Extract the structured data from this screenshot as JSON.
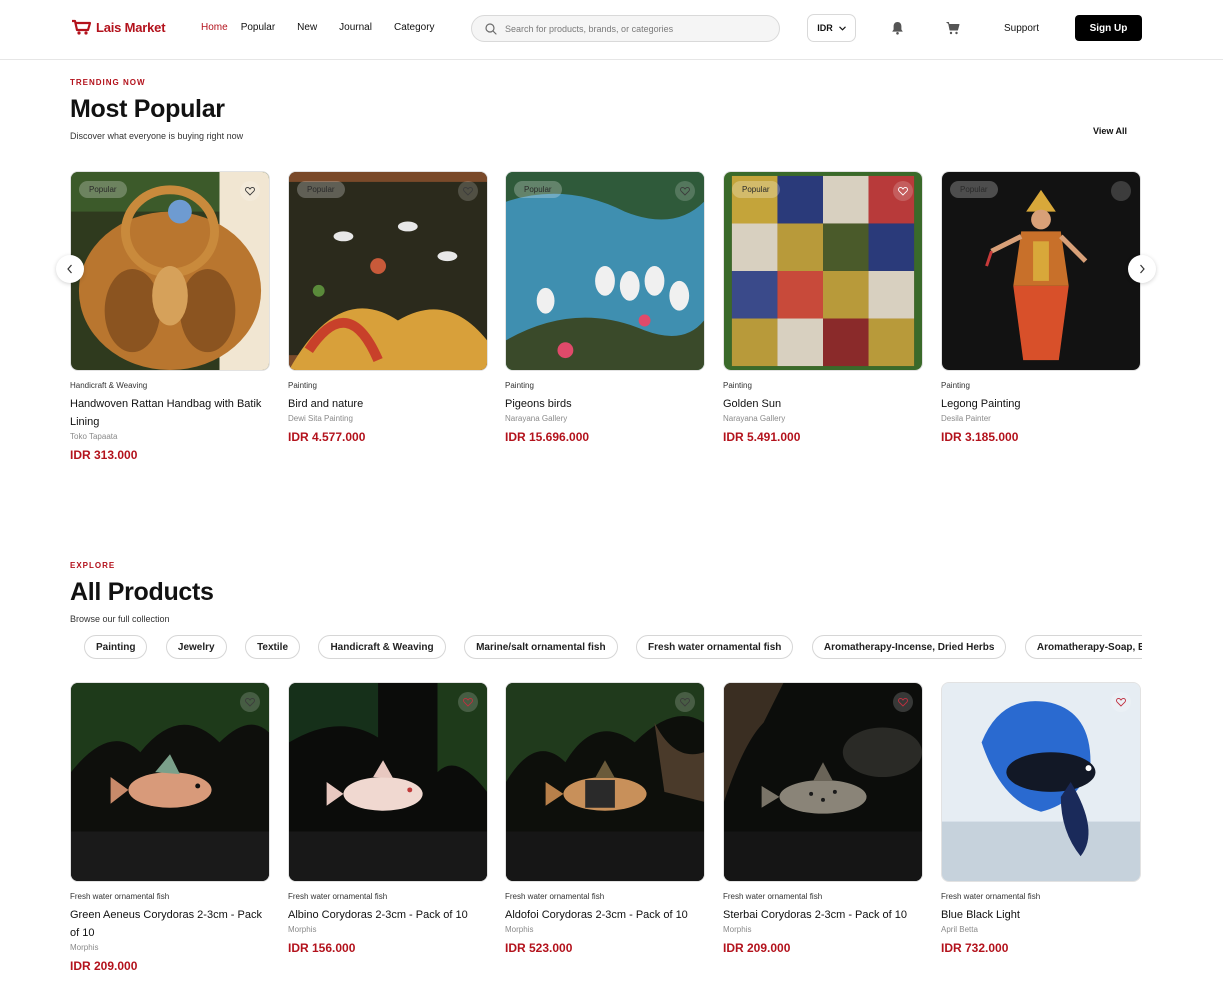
{
  "header": {
    "logo_text": "Lais Market",
    "nav": [
      {
        "label": "Home",
        "active": true
      },
      {
        "label": "Popular"
      },
      {
        "label": "New"
      },
      {
        "label": "Journal"
      },
      {
        "label": "Category"
      }
    ],
    "search_placeholder": "Search for products, brands, or categories",
    "currency": "IDR",
    "support_label": "Support",
    "signup_label": "Sign Up"
  },
  "popular": {
    "eyebrow": "TRENDING NOW",
    "title": "Most Popular",
    "subtitle": "Discover what everyone is buying right now",
    "view_all": "View All",
    "badge_label": "Popular",
    "items": [
      {
        "category": "Handicraft & Weaving",
        "title": "Handwoven Rattan Handbag with Batik Lining",
        "seller": "Toko Tapaata",
        "price": "IDR 313.000"
      },
      {
        "category": "Painting",
        "title": "Bird and nature",
        "seller": "Dewi Sita Painting",
        "price": "IDR 4.577.000"
      },
      {
        "category": "Painting",
        "title": "Pigeons birds",
        "seller": "Narayana Gallery",
        "price": "IDR 15.696.000"
      },
      {
        "category": "Painting",
        "title": "Golden Sun",
        "seller": "Narayana Gallery",
        "price": "IDR 5.491.000"
      },
      {
        "category": "Painting",
        "title": "Legong Painting",
        "seller": "Desila Painter",
        "price": "IDR 3.185.000"
      }
    ]
  },
  "all_products": {
    "eyebrow": "EXPLORE",
    "title": "All Products",
    "subtitle": "Browse our full collection",
    "chips": [
      "Painting",
      "Jewelry",
      "Textile",
      "Handicraft & Weaving",
      "Marine/salt ornamental fish",
      "Fresh water ornamental fish",
      "Aromatherapy-Incense, Dried Herbs",
      "Aromatherapy-Soap, Essential Oils"
    ],
    "items": [
      {
        "category": "Fresh water ornamental fish",
        "title": "Green Aeneus Corydoras 2-3cm - Pack of 10",
        "seller": "Morphis",
        "price": "IDR 209.000"
      },
      {
        "category": "Fresh water ornamental fish",
        "title": "Albino Corydoras 2-3cm - Pack of 10",
        "seller": "Morphis",
        "price": "IDR 156.000"
      },
      {
        "category": "Fresh water ornamental fish",
        "title": "Aldofoi Corydoras 2-3cm - Pack of 10",
        "seller": "Morphis",
        "price": "IDR 523.000"
      },
      {
        "category": "Fresh water ornamental fish",
        "title": "Sterbai Corydoras 2-3cm - Pack of 10",
        "seller": "Morphis",
        "price": "IDR 209.000"
      },
      {
        "category": "Fresh water ornamental fish",
        "title": "Blue Black Light",
        "seller": "April Betta",
        "price": "IDR 732.000"
      }
    ]
  },
  "colors": {
    "brand_red": "#b3121c",
    "text": "#111111",
    "muted": "#8a8a8a"
  },
  "icons": [
    "logo-cart-icon",
    "search-icon",
    "chevron-down-icon",
    "bell-icon",
    "cart-icon",
    "heart-icon",
    "chevron-left-icon",
    "chevron-right-icon"
  ]
}
